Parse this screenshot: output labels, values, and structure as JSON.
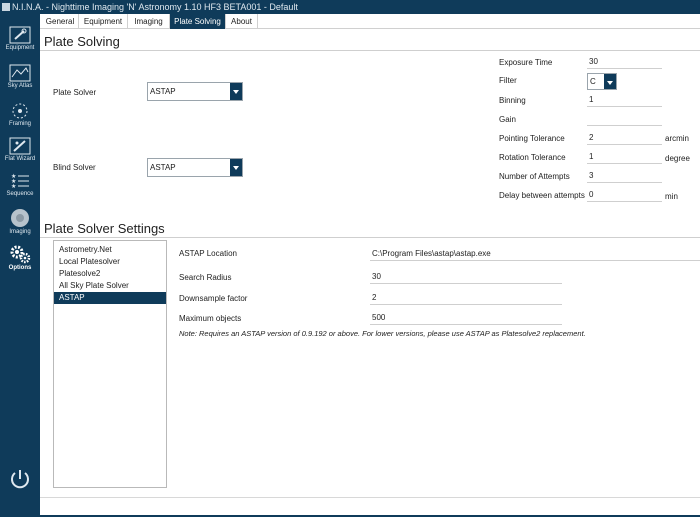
{
  "window": {
    "title": "N.I.N.A. - Nighttime Imaging 'N' Astronomy 1.10 HF3 BETA001  -  Default"
  },
  "sidebar": {
    "items": [
      {
        "label": "Equipment",
        "icon": "telescope-icon"
      },
      {
        "label": "Sky Atlas",
        "icon": "map-icon"
      },
      {
        "label": "Framing",
        "icon": "framing-icon"
      },
      {
        "label": "Flat Wizard",
        "icon": "flat-wizard-icon"
      },
      {
        "label": "Sequence",
        "icon": "sequence-icon"
      },
      {
        "label": "Imaging",
        "icon": "imaging-icon"
      },
      {
        "label": "Options",
        "icon": "gears-icon"
      }
    ],
    "power_icon": "power-icon"
  },
  "tabs": [
    {
      "label": "General"
    },
    {
      "label": "Equipment"
    },
    {
      "label": "Imaging"
    },
    {
      "label": "Plate Solving"
    },
    {
      "label": "About"
    }
  ],
  "plate_solving": {
    "heading": "Plate Solving",
    "plate_solver_label": "Plate Solver",
    "plate_solver_value": "ASTAP",
    "blind_solver_label": "Blind Solver",
    "blind_solver_value": "ASTAP",
    "fields": [
      {
        "label": "Exposure Time",
        "value": "30",
        "unit": ""
      },
      {
        "label": "Filter",
        "value": "C",
        "unit": ""
      },
      {
        "label": "Binning",
        "value": "1",
        "unit": ""
      },
      {
        "label": "Gain",
        "value": "",
        "unit": ""
      },
      {
        "label": "Pointing Tolerance",
        "value": "2",
        "unit": "arcmin"
      },
      {
        "label": "Rotation Tolerance",
        "value": "1",
        "unit": "degree"
      },
      {
        "label": "Number of Attempts",
        "value": "3",
        "unit": ""
      },
      {
        "label": "Delay between attempts",
        "value": "0",
        "unit": "min"
      }
    ]
  },
  "settings": {
    "heading": "Plate Solver Settings",
    "solvers": [
      "Astrometry.Net",
      "Local Platesolver",
      "Platesolve2",
      "All Sky Plate Solver",
      "ASTAP"
    ],
    "selected_index": 4,
    "astap_location_label": "ASTAP Location",
    "astap_location_value": "C:\\Program Files\\astap\\astap.exe",
    "search_radius_label": "Search Radius",
    "search_radius_value": "30",
    "downsample_label": "Downsample factor",
    "downsample_value": "2",
    "max_objects_label": "Maximum objects",
    "max_objects_value": "500",
    "note": "Note: Requires an ASTAP version of 0.9.192 or above. For lower versions, please use ASTAP as Platesolve2 replacement."
  },
  "colors": {
    "accent": "#0f3b5a",
    "text": "#222222"
  }
}
